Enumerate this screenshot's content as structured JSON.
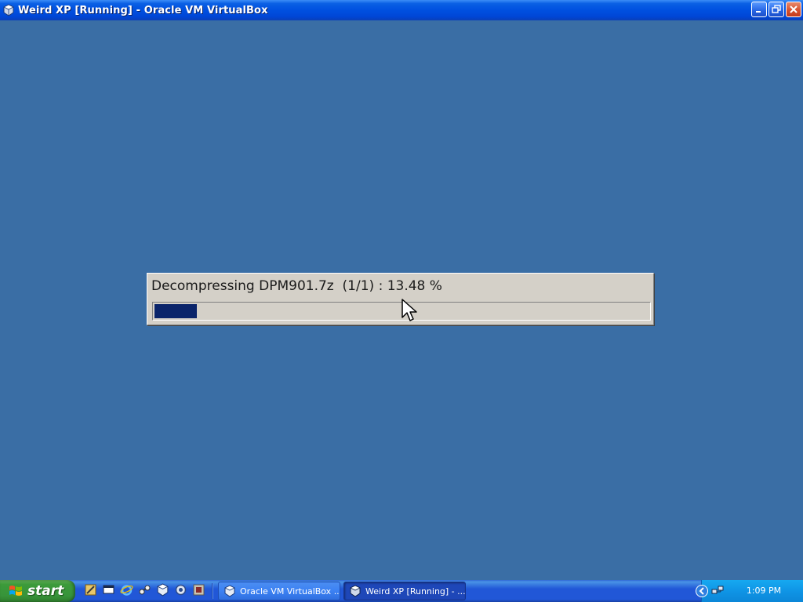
{
  "window": {
    "title": "Weird XP [Running] - Oracle VM VirtualBox",
    "icon": "virtualbox-icon",
    "controls": [
      "minimize",
      "restore",
      "close"
    ]
  },
  "progress_dialog": {
    "text": "Decompressing DPM901.7z  (1/1) : 13.48 %",
    "percent": 13.48,
    "fill_color": "#0a246a"
  },
  "taskbar": {
    "start_label": "start",
    "quick_launch": [
      "tools-icon",
      "show-desktop-icon",
      "internet-explorer-icon",
      "network-icon",
      "virtualbox-icon",
      "settings-icon",
      "media-icon"
    ],
    "tasks": [
      {
        "label": "Oracle VM VirtualBox ...",
        "icon": "virtualbox-icon",
        "active": false
      },
      {
        "label": "Weird XP [Running] - ...",
        "icon": "virtualbox-icon",
        "active": true
      }
    ],
    "clock": "1:09 PM"
  },
  "colors": {
    "desktop": "#3a6ea5",
    "titlebar": "#0050e0",
    "taskbar": "#2157d7",
    "start_button": "#3c9a3a",
    "tray": "#0f95e6"
  }
}
